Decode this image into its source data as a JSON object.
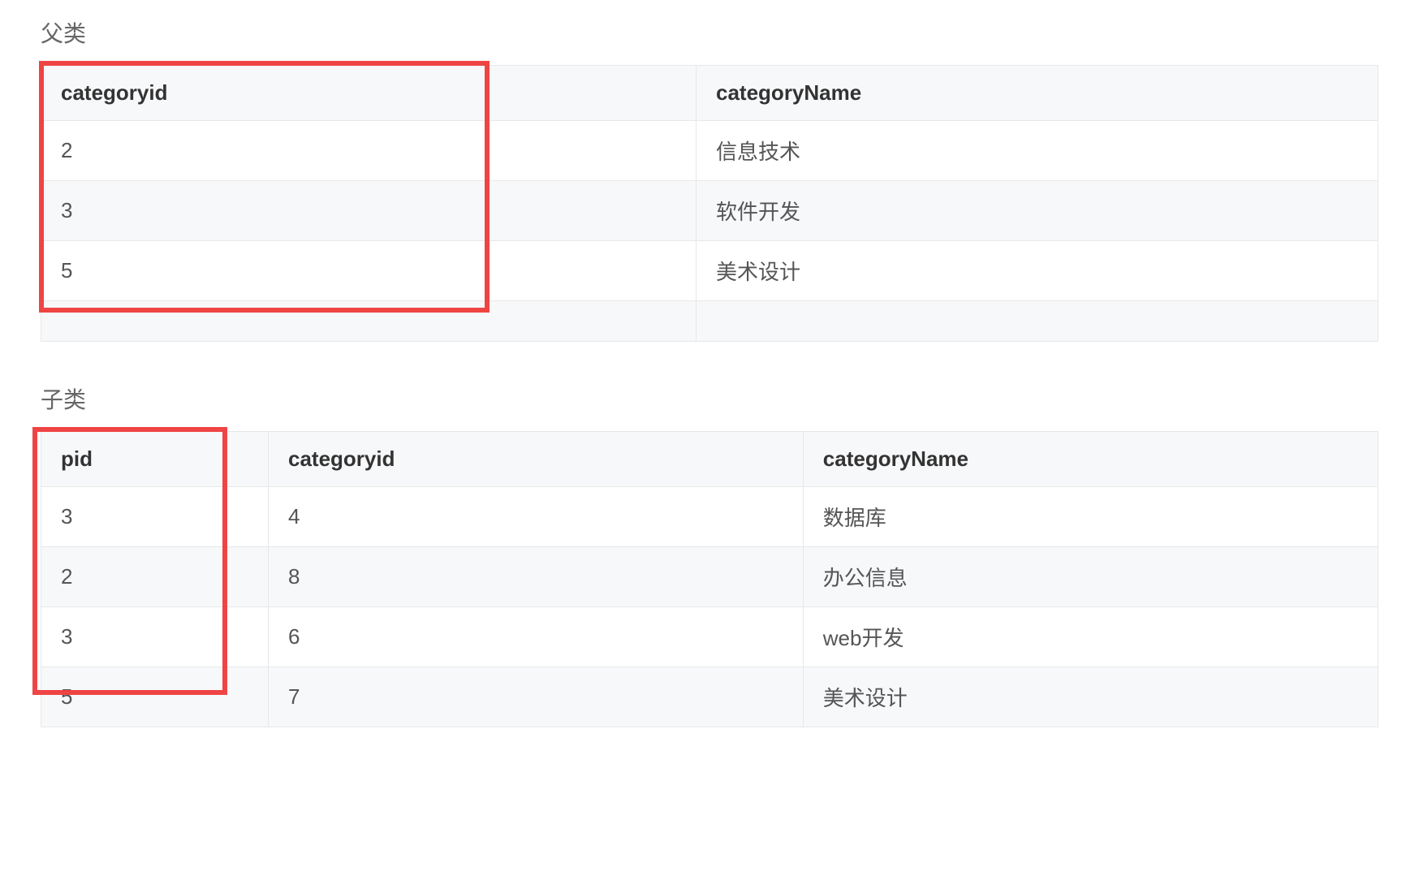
{
  "parent": {
    "title": "父类",
    "headers": [
      "categoryid",
      "categoryName"
    ],
    "rows": [
      [
        "2",
        "信息技术"
      ],
      [
        "3",
        "软件开发"
      ],
      [
        "5",
        "美术设计"
      ]
    ]
  },
  "child": {
    "title": "子类",
    "headers": [
      "pid",
      "categoryid",
      "categoryName"
    ],
    "rows": [
      [
        "3",
        "4",
        "数据库"
      ],
      [
        "2",
        "8",
        "办公信息"
      ],
      [
        "3",
        "6",
        "web开发"
      ],
      [
        "5",
        "7",
        "美术设计"
      ]
    ]
  }
}
